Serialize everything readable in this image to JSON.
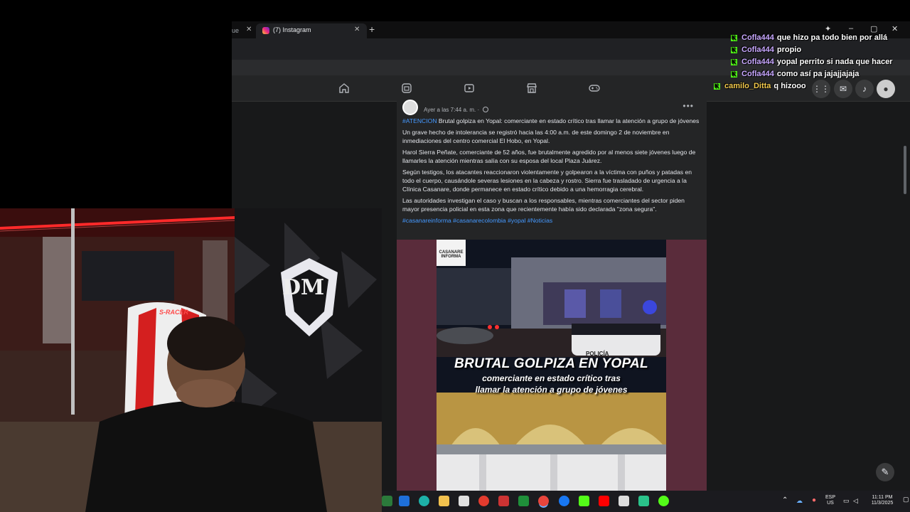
{
  "browser": {
    "tabs": [
      {
        "label": "(7) Instagram",
        "active": true
      }
    ],
    "new_tab_label": "+",
    "window_controls": {
      "minimize": "–",
      "maximize": "▢",
      "close": "✕"
    }
  },
  "facebook_nav": {
    "icons": [
      "home-icon",
      "reels-icon",
      "video-icon",
      "marketplace-icon",
      "gaming-icon"
    ],
    "right_icons": [
      "menu-grid-icon",
      "messenger-icon",
      "notifications-icon",
      "profile-avatar"
    ]
  },
  "post": {
    "timestamp": "Ayer a las 7:44 a. m. ·",
    "paragraphs": [
      {
        "hashtag": "#ATENCION",
        "text": " Brutal golpiza en Yopal: comerciante en estado crítico tras llamar la atención a grupo de jóvenes"
      },
      {
        "hashtag": "",
        "text": "Un grave hecho de intolerancia se registró hacia las 4:00 a.m. de este domingo 2 de noviembre en inmediaciones del centro comercial El Hobo, en Yopal."
      },
      {
        "hashtag": "",
        "text": "Harol Sierra Peñate, comerciante de 52 años, fue brutalmente agredido por al menos siete jóvenes luego de llamarles la atención mientras salía con su esposa del local Plaza Juárez."
      },
      {
        "hashtag": "",
        "text": "Según testigos, los atacantes reaccionaron violentamente y golpearon a la víctima con puños y patadas en todo el cuerpo, causándole severas lesiones en la cabeza y rostro. Sierra fue trasladado de urgencia a la Clínica Casanare, donde permanece en estado crítico debido a una hemorragia cerebral."
      },
      {
        "hashtag": "",
        "text": "Las autoridades investigan el caso y buscan a los responsables, mientras comerciantes del sector piden mayor presencia policial en esta zona que recientemente había sido declarada \"zona segura\"."
      }
    ],
    "hashtags": "#casanareinforma #casanarecolombia #yopal #Noticias",
    "media": {
      "logo_line1": "CASANARE",
      "logo_line2": "INFORMA",
      "headline": "BRUTAL GOLPIZA EN YOPAL",
      "subheadline_1": "comerciante en estado crítico tras",
      "subheadline_2": "llamar la atención a grupo de jóvenes",
      "police_label": "POLICÍA"
    }
  },
  "chat": [
    {
      "user": "Cofla444",
      "message": "que hizo pa todo bien por allá"
    },
    {
      "user": "Cofla444",
      "message": "propio"
    },
    {
      "user": "Cofla444",
      "message": "yopal perrito si nada que hacer"
    },
    {
      "user": "Cofla444",
      "message": "como así pa jajajjajaja"
    },
    {
      "user": "camilo_Ditta",
      "message": "q hizooo"
    }
  ],
  "webcam": {
    "logo": "DM",
    "chair_brand": "S-RACER"
  },
  "taskbar": {
    "lang_line1": "ESP",
    "lang_line2": "US",
    "time": "11:11 PM",
    "date": "11/3/2025"
  },
  "colors": {
    "hashtag": "#4599ff",
    "kick_green": "#53fc18",
    "post_bg": "#242526",
    "led_red": "#ff2a2a"
  }
}
